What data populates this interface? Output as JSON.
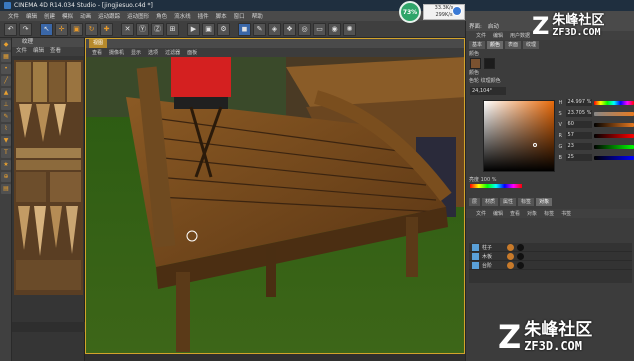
{
  "window": {
    "title": "CINEMA 4D R14.034 Studio - [jingjiesuo.c4d *]"
  },
  "menubar": [
    "文件",
    "编辑",
    "创建",
    "模拟",
    "动画",
    "运动跟踪",
    "运动图形",
    "角色",
    "流水线",
    "插件",
    "脚本",
    "窗口",
    "帮助"
  ],
  "toolbar_icons": [
    "undo-icon",
    "redo-icon",
    "select-icon",
    "move-icon",
    "scale-icon",
    "rotate-icon",
    "recent-tools-icon",
    "axis-x-icon",
    "axis-y-icon",
    "axis-z-icon",
    "coordinate-icon",
    "render-view-icon",
    "render-icon",
    "render-settings-icon",
    "cube-icon",
    "pen-icon",
    "subdivide-icon",
    "array-icon",
    "deformer-icon",
    "floor-icon",
    "camera-icon",
    "light-icon"
  ],
  "texture_panel": {
    "header": "纹理",
    "menu": [
      "文件",
      "编辑",
      "查看"
    ]
  },
  "viewport": {
    "tab": "视图",
    "menu": [
      "查看",
      "摄像机",
      "显示",
      "选项",
      "过滤器",
      "面板"
    ]
  },
  "system_badge": {
    "percent": "73%",
    "speed_up": "33.3K/s",
    "speed_down": "299K/s"
  },
  "right_panel": {
    "layout_label": "界面:",
    "layout_value": "启动",
    "menu": [
      "文件",
      "编辑",
      "用户数据"
    ],
    "tabs": [
      "基本",
      "颜色",
      "表面",
      "纹理"
    ],
    "active_tab": "颜色",
    "color_section": "颜色",
    "swatch_section": "颜色",
    "mode_label": "色轮",
    "mode_value": "纹理颜色",
    "hex_value": "24,104°",
    "sliders": [
      {
        "k": "H",
        "v": "24.997 %"
      },
      {
        "k": "S",
        "v": "23.705 %"
      },
      {
        "k": "V",
        "v": "60"
      },
      {
        "k": "R",
        "v": "57"
      },
      {
        "k": "G",
        "v": "23"
      },
      {
        "k": "B",
        "v": "25"
      }
    ],
    "brightness_label": "亮度",
    "brightness_value": "100 %",
    "bottom_tabs": [
      "层",
      "材质",
      "属性",
      "标签",
      "对象"
    ],
    "bottom_menu": [
      "文件",
      "编辑",
      "查看",
      "对象",
      "标签",
      "书签"
    ],
    "objects": [
      "柱子",
      "木板",
      "台阶"
    ]
  },
  "watermark_top": {
    "brand": "朱峰社区",
    "domain": "ZF3D.COM"
  },
  "watermark_bottom": {
    "brand": "朱峰社区",
    "domain": "ZF3D.COM"
  },
  "colors": {
    "accent": "#d2a32b",
    "brand_green": "#2fa56a",
    "panel": "#3c3c3c"
  }
}
